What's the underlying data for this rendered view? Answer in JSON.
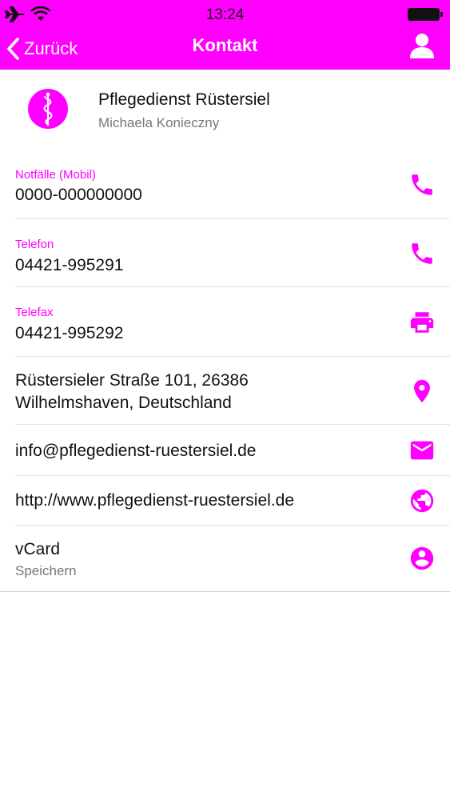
{
  "status_bar": {
    "time": "13:24"
  },
  "nav": {
    "back_label": "Zurück",
    "title": "Kontakt"
  },
  "contact": {
    "name": "Pflegedienst Rüstersiel",
    "person": "Michaela Konieczny"
  },
  "rows": [
    {
      "label": "Notfälle (Mobil)",
      "value": "0000-000000000",
      "icon": "phone-icon"
    },
    {
      "label": "Telefon",
      "value": "04421-995291",
      "icon": "phone-icon"
    },
    {
      "label": "Telefax",
      "value": "04421-995292",
      "icon": "printer-icon"
    },
    {
      "address_line1": "Rüstersieler Straße 101, 26386",
      "address_line2": "Wilhelmshaven, Deutschland",
      "icon": "location-pin-icon"
    },
    {
      "value": "info@pflegedienst-ruestersiel.de",
      "icon": "mail-icon"
    },
    {
      "value": "http://www.pflegedienst-ruestersiel.de",
      "icon": "globe-icon"
    },
    {
      "value": "vCard",
      "sub": "Speichern",
      "icon": "account-circle-icon"
    }
  ],
  "colors": {
    "accent": "#ff00ff",
    "text": "#111111",
    "secondary": "#777777",
    "divider": "#e2e2e2"
  }
}
